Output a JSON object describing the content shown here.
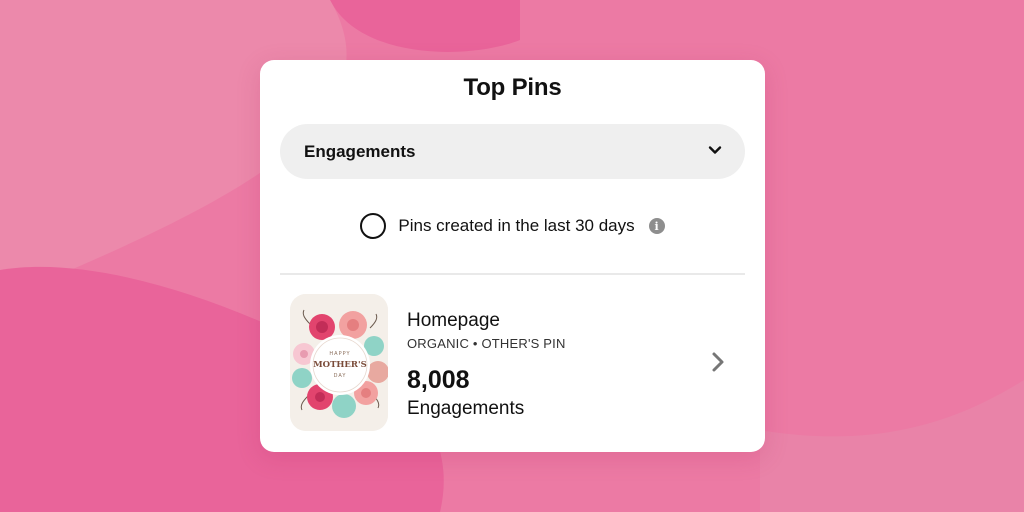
{
  "colors": {
    "background": "#ec7aa4",
    "card": "#ffffff",
    "dropdown_bg": "#efefef",
    "text": "#111111",
    "icon_gray": "#8e8e8e"
  },
  "card": {
    "title": "Top Pins",
    "metric_dropdown": {
      "selected": "Engagements",
      "icon": "chevron-down-icon"
    },
    "filter": {
      "checked": false,
      "label": "Pins created in the last 30 days",
      "info_icon": "info-icon",
      "info_glyph": "i"
    },
    "pins": [
      {
        "name": "Homepage",
        "meta": "ORGANIC • OTHER'S PIN",
        "value": "8,008",
        "metric": "Engagements",
        "thumbnail": {
          "line1": "HAPPY",
          "line2": "MOTHER'S",
          "line3": "DAY"
        },
        "icon": "chevron-right-icon"
      }
    ]
  }
}
